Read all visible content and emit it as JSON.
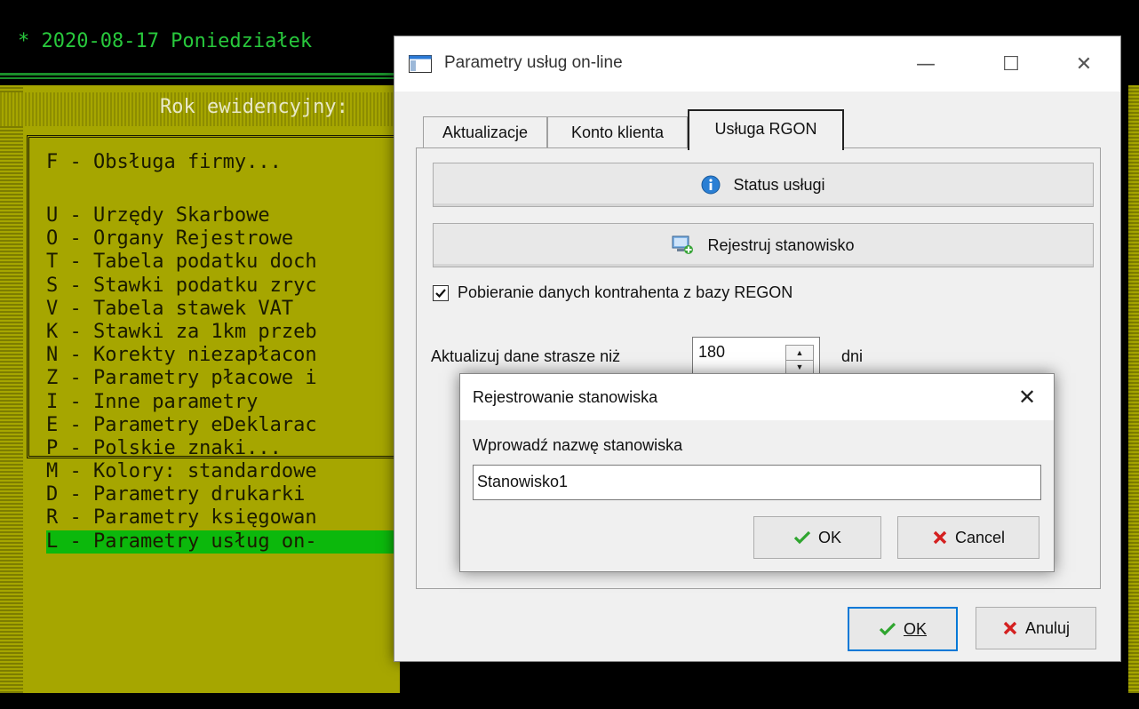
{
  "console": {
    "title_line": "* 2020-08-17 Poniedziałek",
    "year_label": "Rok ewidencyjny:",
    "menu_header": "F - Obsługa firmy...",
    "menu_items": [
      "U - Urzędy Skarbowe",
      "O - Organy Rejestrowe",
      "T - Tabela podatku doch",
      "S - Stawki podatku zryc",
      "V - Tabela stawek VAT",
      "K - Stawki za 1km przeb",
      "N - Korekty niezapłacon",
      "Z - Parametry płacowe i",
      "I - Inne parametry",
      "E - Parametry eDeklarac",
      "P - Polskie znaki...",
      "M - Kolory: standardowe",
      "D - Parametry drukarki",
      "R - Parametry księgowan",
      "L - Parametry usług on-"
    ],
    "selected_index": 14,
    "colors": {
      "background": "#000000",
      "panel": "#a6a600",
      "accent": "#28c83c",
      "selection": "#0cb80c"
    }
  },
  "dialog": {
    "title": "Parametry usług on-line",
    "tabs": [
      "Aktualizacje",
      "Konto klienta",
      "Usługa RGON"
    ],
    "active_tab": "Usługa RGON",
    "status_button": "Status usługi",
    "register_button": "Rejestruj stanowisko",
    "checkbox_label": "Pobieranie danych kontrahenta z bazy REGON",
    "checkbox_checked": true,
    "update_label": "Aktualizuj dane strasze niż",
    "update_value": "180",
    "update_unit": "dni",
    "ok_label": "OK",
    "cancel_label": "Anuluj",
    "icons": {
      "status": "info-icon",
      "register": "computer-add-icon",
      "ok": "checkmark-icon",
      "cancel": "x-icon"
    }
  },
  "subdialog": {
    "title": "Rejestrowanie stanowiska",
    "prompt": "Wprowadź nazwę stanowiska",
    "input_value": "Stanowisko1",
    "ok_label": "OK",
    "cancel_label": "Cancel"
  }
}
